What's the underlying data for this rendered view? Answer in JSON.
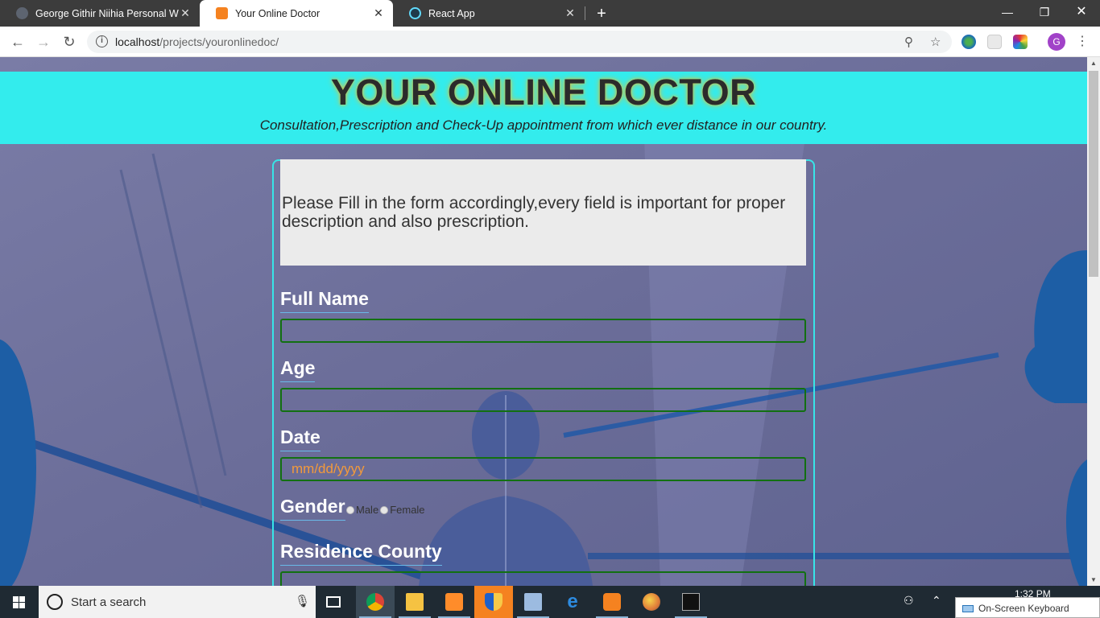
{
  "browser": {
    "tabs": [
      {
        "title": "George Githir Niihia Personal We",
        "active": false
      },
      {
        "title": "Your Online Doctor",
        "active": true
      },
      {
        "title": "React App",
        "active": false
      }
    ],
    "new_tab": "+",
    "url_host": "localhost",
    "url_path": "/projects/youronlinedoc/",
    "profile_initial": "G"
  },
  "page": {
    "title": "YOUR ONLINE DOCTOR",
    "tagline": "Consultation,Prescription and Check-Up appointment from which ever distance in our country.",
    "notice": "Please Fill in the form accordingly,every field is important for proper description and also prescription.",
    "fields": {
      "full_name": {
        "label": "Full Name",
        "value": ""
      },
      "age": {
        "label": "Age",
        "value": ""
      },
      "date": {
        "label": "Date",
        "placeholder": "mm/dd/yyyy"
      },
      "gender": {
        "label": "Gender",
        "options": [
          "Male",
          "Female"
        ]
      },
      "county": {
        "label": "Residence County",
        "value": ""
      }
    }
  },
  "taskbar": {
    "search_placeholder": "Start a search",
    "clock": "1:32 PM",
    "osk_label": "On-Screen Keyboard"
  },
  "colors": {
    "header_bg": "#33eced",
    "panel_border": "#37e5e7",
    "input_border": "#127011",
    "placeholder": "#f39a3b"
  }
}
